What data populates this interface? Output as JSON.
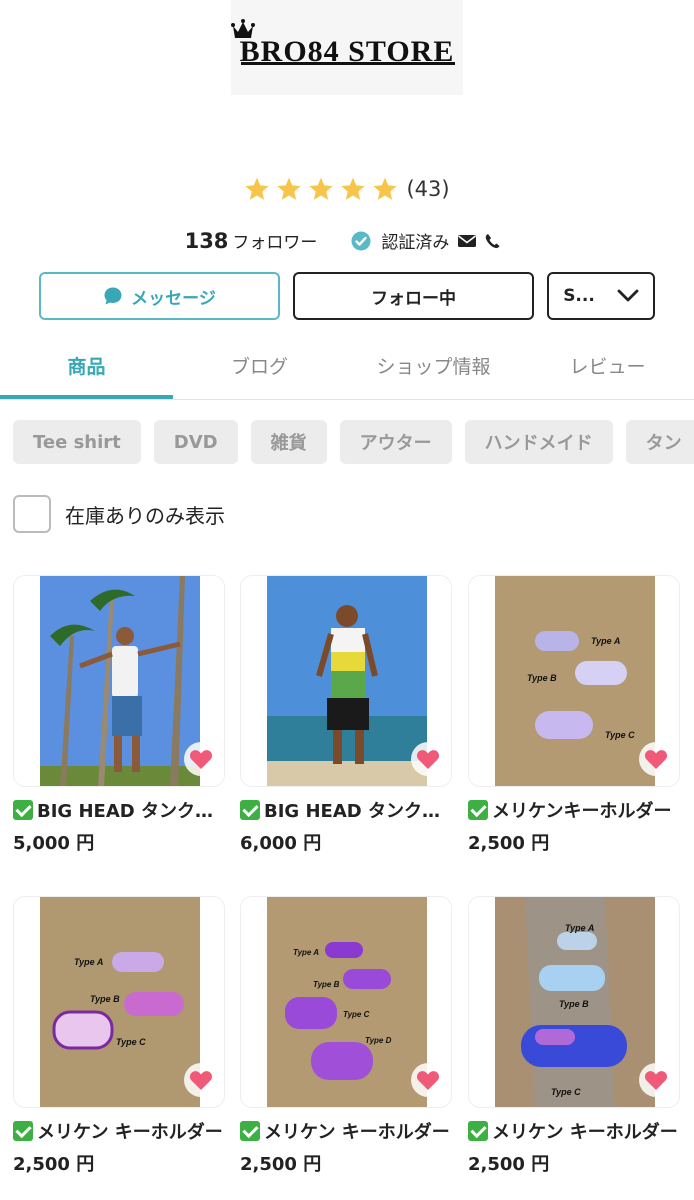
{
  "shop": {
    "logo_text": "BRO84 STORE",
    "rating_count": "(43)",
    "rating_stars": 5,
    "followers_count": "138",
    "followers_label": "フォロワー",
    "verified_label": "認証済み",
    "accent_color": "#3aa7b6",
    "star_color": "#f5c64a",
    "heart_color": "#f05a78"
  },
  "actions": {
    "message_label": "メッセージ",
    "follow_label": "フォロー中",
    "more_label": "S..."
  },
  "tabs": [
    {
      "label": "商品",
      "active": true
    },
    {
      "label": "ブログ",
      "active": false
    },
    {
      "label": "ショップ情報",
      "active": false
    },
    {
      "label": "レビュー",
      "active": false
    }
  ],
  "categories": [
    "Tee shirt",
    "DVD",
    "雑貨",
    "アウター",
    "ハンドメイド",
    "タン"
  ],
  "filter": {
    "stock_only_label": "在庫ありのみ表示",
    "checked": false
  },
  "products": [
    {
      "title": "BIG HEAD タンクトップ",
      "price": "5,000 円",
      "image": "man-palm-trees"
    },
    {
      "title": "BIG HEAD タンクトップ",
      "price": "6,000 円",
      "image": "man-beach"
    },
    {
      "title": "メリケンキーホルダー",
      "price": "2,500 円",
      "image": "knuckles-sand-abc"
    },
    {
      "title": "メリケン キーホルダー",
      "price": "2,500 円",
      "image": "knuckles-sand-abc-pink"
    },
    {
      "title": "メリケン キーホルダー",
      "price": "2,500 円",
      "image": "knuckles-sand-abcd-purple"
    },
    {
      "title": "メリケン キーホルダー",
      "price": "2,500 円",
      "image": "knuckles-driftwood-blue"
    }
  ]
}
